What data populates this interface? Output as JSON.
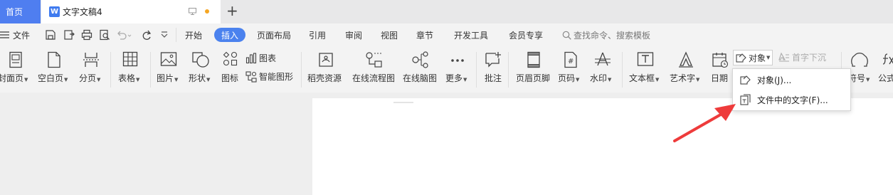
{
  "tabs": {
    "home": "首页",
    "document": "文字文稿4",
    "new_tab": "+"
  },
  "menu": {
    "file": "文件",
    "items": [
      "开始",
      "插入",
      "页面布局",
      "引用",
      "审阅",
      "视图",
      "章节",
      "开发工具",
      "会员专享"
    ],
    "active": "插入",
    "search_placeholder": "查找命令、搜索模板"
  },
  "ribbon": {
    "cover_page": "封面页",
    "blank_page": "空白页",
    "page_break": "分页",
    "table": "表格",
    "picture": "图片",
    "shape": "形状",
    "icon": "图标",
    "chart": "图表",
    "smart_art": "智能图形",
    "docer_resources": "稻壳资源",
    "online_flowchart": "在线流程图",
    "online_mindmap": "在线脑图",
    "more": "更多",
    "comment": "批注",
    "header_footer": "页眉页脚",
    "page_number": "页码",
    "watermark": "水印",
    "text_box": "文本框",
    "word_art": "艺术字",
    "date": "日期",
    "object": "对象",
    "drop_cap": "首字下沉",
    "symbol": "符号",
    "formula": "公式"
  },
  "dropdown": {
    "object_item": "对象(J)...",
    "text_from_file": "文件中的文字(F)..."
  },
  "colors": {
    "accent": "#4b82ee",
    "home_tab": "#4f7ef0",
    "arrow": "#ee3b3b",
    "unsaved_dot": "#f5a623"
  }
}
